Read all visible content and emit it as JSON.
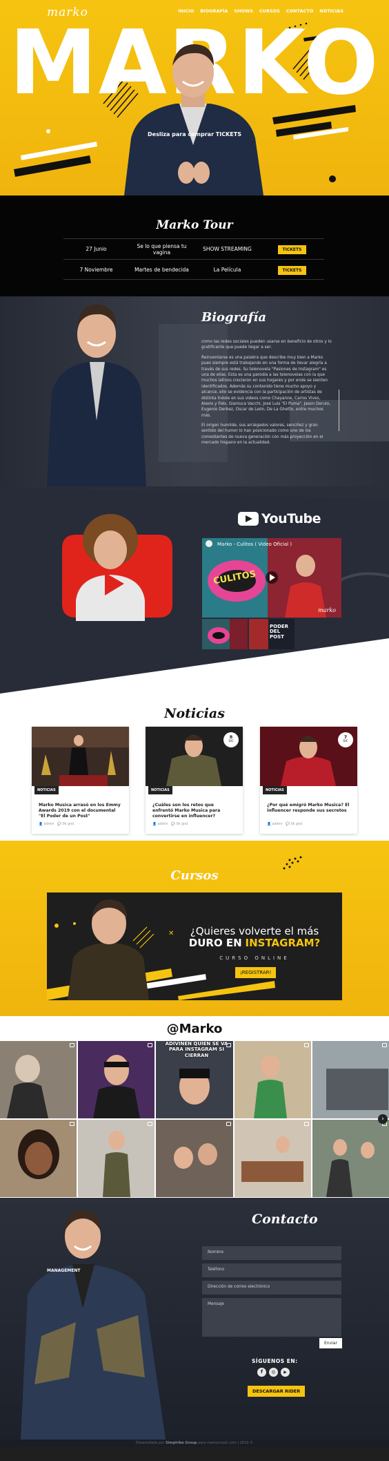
{
  "brand": {
    "logo_text": "marko",
    "yellow": "#f6c410",
    "dark": "#050505"
  },
  "nav": {
    "items": [
      "INICIO",
      "BIOGRAFÍA",
      "SHOWS",
      "CURSOS",
      "CONTACTO",
      "NOTICIAS"
    ]
  },
  "hero": {
    "name": "MARKO",
    "cta": "Desliza para comprar TICKETS"
  },
  "tour": {
    "title": "Marko Tour",
    "rows": [
      {
        "date": "27 Junio",
        "show": "Se lo que piensa tu vagina",
        "venue": "SHOW STREAMING",
        "button": "TICKETS"
      },
      {
        "date": "7 Noviembre",
        "show": "Martes de bendecida",
        "venue": "La Película",
        "button": "TICKETS"
      }
    ]
  },
  "bio": {
    "title": "Biografía",
    "paragraphs": [
      "como las redes sociales pueden usarse en beneficio de otros y lo gratificante que puede llegar a ser.",
      "Reinventarse es una palabra que describe muy bien a Marko pues siempre está trabajando en una forma de llevar alegría a través de sus redes. Su telenovela \"Pasiones de Instagram\" es una de ellas. Esta es una parodia a las telenovelas con la que muchos latinos crecieron en sus hogares y por ende se sienten identificados. Además su contenido tiene mucho apoyo y alcance, ello se evidencia con la participación de artistas de distinta índole en sus videos como Chayanne, Carlos Vives, Alexis y Fido, Gianluca Vacchi, José Luis \"El Puma\", Jason Derulo, Eugenio Derbez, Oscar de León, De La Ghetto, entre muchos más.",
      "El origen humilde, sus arraigados valores, sencillez y gran sentido del humor lo han posicionado como uno de los comediantes de nueva generación con más proyección en el mercado hispano en la actualidad."
    ]
  },
  "youtube": {
    "logo_text": "YouTube",
    "video_title": "Marko - Culitos ( Video Oficial )",
    "video_overlay": "CULITOS",
    "thumb2_text": "PODER DEL POST",
    "watermark": "marko"
  },
  "news": {
    "title": "Noticias",
    "cards": [
      {
        "tag": "NOTICIAS",
        "day": "",
        "month": "",
        "headline": "Marko Musica arrasó en los Emmy Awards 2019 con el documental \"El Poder de un Post\"",
        "author": "admin",
        "comments": "0k gnd"
      },
      {
        "tag": "NOTICIAS",
        "day": "8",
        "month": "DIC",
        "headline": "¿Cuáles son los retos que enfrentó Marko Musica para convertirse en influencer?",
        "author": "admin",
        "comments": "0k gnd"
      },
      {
        "tag": "NOTICIAS",
        "day": "7",
        "month": "DIC",
        "headline": "¿Por qué emigró Marko Musica? El influencer responde sus secretos",
        "author": "admin",
        "comments": "0k gnd"
      }
    ]
  },
  "cursos": {
    "title": "Cursos",
    "question_1": "¿Quieres volverte el más",
    "question_2": "DURO EN",
    "question_3": "INSTAGRAM?",
    "subtitle": "CURSO ONLINE",
    "button": "¡REGISTRAR!"
  },
  "instagram": {
    "title": "@Marko",
    "caption": "ADIVINEN QUIEN SE VA PARA INSTAGRAM SI CIERRAN",
    "arrow": "›"
  },
  "contact": {
    "title": "Contacto",
    "manage_label": "MANAGEMENT",
    "fields": [
      {
        "placeholder": "Nombre"
      },
      {
        "placeholder": "Teléfono"
      },
      {
        "placeholder": "Dirección de correo electrónico"
      },
      {
        "placeholder": "Mensaje"
      }
    ],
    "send": "Enviar",
    "follow": "SÍGUENOS EN:",
    "socials": [
      {
        "icon": "facebook-icon",
        "glyph": "f"
      },
      {
        "icon": "instagram-icon",
        "glyph": "◎"
      },
      {
        "icon": "youtube-icon",
        "glyph": "▶"
      }
    ],
    "rider": "DESCARGAR RIDER"
  },
  "footer": {
    "text_pre": "Desarrollado por",
    "company": "Simplrike Group",
    "text_post": "para markomusic.com | 2019 ©"
  }
}
